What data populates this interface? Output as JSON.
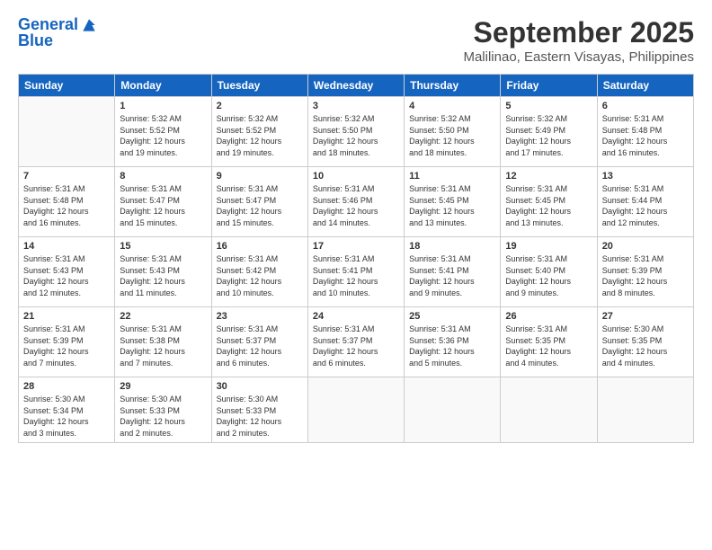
{
  "logo": {
    "line1": "General",
    "line2": "Blue"
  },
  "title": "September 2025",
  "location": "Malilinao, Eastern Visayas, Philippines",
  "days_of_week": [
    "Sunday",
    "Monday",
    "Tuesday",
    "Wednesday",
    "Thursday",
    "Friday",
    "Saturday"
  ],
  "weeks": [
    [
      {
        "day": "",
        "info": ""
      },
      {
        "day": "1",
        "info": "Sunrise: 5:32 AM\nSunset: 5:52 PM\nDaylight: 12 hours\nand 19 minutes."
      },
      {
        "day": "2",
        "info": "Sunrise: 5:32 AM\nSunset: 5:52 PM\nDaylight: 12 hours\nand 19 minutes."
      },
      {
        "day": "3",
        "info": "Sunrise: 5:32 AM\nSunset: 5:50 PM\nDaylight: 12 hours\nand 18 minutes."
      },
      {
        "day": "4",
        "info": "Sunrise: 5:32 AM\nSunset: 5:50 PM\nDaylight: 12 hours\nand 18 minutes."
      },
      {
        "day": "5",
        "info": "Sunrise: 5:32 AM\nSunset: 5:49 PM\nDaylight: 12 hours\nand 17 minutes."
      },
      {
        "day": "6",
        "info": "Sunrise: 5:31 AM\nSunset: 5:48 PM\nDaylight: 12 hours\nand 16 minutes."
      }
    ],
    [
      {
        "day": "7",
        "info": "Sunrise: 5:31 AM\nSunset: 5:48 PM\nDaylight: 12 hours\nand 16 minutes."
      },
      {
        "day": "8",
        "info": "Sunrise: 5:31 AM\nSunset: 5:47 PM\nDaylight: 12 hours\nand 15 minutes."
      },
      {
        "day": "9",
        "info": "Sunrise: 5:31 AM\nSunset: 5:47 PM\nDaylight: 12 hours\nand 15 minutes."
      },
      {
        "day": "10",
        "info": "Sunrise: 5:31 AM\nSunset: 5:46 PM\nDaylight: 12 hours\nand 14 minutes."
      },
      {
        "day": "11",
        "info": "Sunrise: 5:31 AM\nSunset: 5:45 PM\nDaylight: 12 hours\nand 13 minutes."
      },
      {
        "day": "12",
        "info": "Sunrise: 5:31 AM\nSunset: 5:45 PM\nDaylight: 12 hours\nand 13 minutes."
      },
      {
        "day": "13",
        "info": "Sunrise: 5:31 AM\nSunset: 5:44 PM\nDaylight: 12 hours\nand 12 minutes."
      }
    ],
    [
      {
        "day": "14",
        "info": "Sunrise: 5:31 AM\nSunset: 5:43 PM\nDaylight: 12 hours\nand 12 minutes."
      },
      {
        "day": "15",
        "info": "Sunrise: 5:31 AM\nSunset: 5:43 PM\nDaylight: 12 hours\nand 11 minutes."
      },
      {
        "day": "16",
        "info": "Sunrise: 5:31 AM\nSunset: 5:42 PM\nDaylight: 12 hours\nand 10 minutes."
      },
      {
        "day": "17",
        "info": "Sunrise: 5:31 AM\nSunset: 5:41 PM\nDaylight: 12 hours\nand 10 minutes."
      },
      {
        "day": "18",
        "info": "Sunrise: 5:31 AM\nSunset: 5:41 PM\nDaylight: 12 hours\nand 9 minutes."
      },
      {
        "day": "19",
        "info": "Sunrise: 5:31 AM\nSunset: 5:40 PM\nDaylight: 12 hours\nand 9 minutes."
      },
      {
        "day": "20",
        "info": "Sunrise: 5:31 AM\nSunset: 5:39 PM\nDaylight: 12 hours\nand 8 minutes."
      }
    ],
    [
      {
        "day": "21",
        "info": "Sunrise: 5:31 AM\nSunset: 5:39 PM\nDaylight: 12 hours\nand 7 minutes."
      },
      {
        "day": "22",
        "info": "Sunrise: 5:31 AM\nSunset: 5:38 PM\nDaylight: 12 hours\nand 7 minutes."
      },
      {
        "day": "23",
        "info": "Sunrise: 5:31 AM\nSunset: 5:37 PM\nDaylight: 12 hours\nand 6 minutes."
      },
      {
        "day": "24",
        "info": "Sunrise: 5:31 AM\nSunset: 5:37 PM\nDaylight: 12 hours\nand 6 minutes."
      },
      {
        "day": "25",
        "info": "Sunrise: 5:31 AM\nSunset: 5:36 PM\nDaylight: 12 hours\nand 5 minutes."
      },
      {
        "day": "26",
        "info": "Sunrise: 5:31 AM\nSunset: 5:35 PM\nDaylight: 12 hours\nand 4 minutes."
      },
      {
        "day": "27",
        "info": "Sunrise: 5:30 AM\nSunset: 5:35 PM\nDaylight: 12 hours\nand 4 minutes."
      }
    ],
    [
      {
        "day": "28",
        "info": "Sunrise: 5:30 AM\nSunset: 5:34 PM\nDaylight: 12 hours\nand 3 minutes."
      },
      {
        "day": "29",
        "info": "Sunrise: 5:30 AM\nSunset: 5:33 PM\nDaylight: 12 hours\nand 2 minutes."
      },
      {
        "day": "30",
        "info": "Sunrise: 5:30 AM\nSunset: 5:33 PM\nDaylight: 12 hours\nand 2 minutes."
      },
      {
        "day": "",
        "info": ""
      },
      {
        "day": "",
        "info": ""
      },
      {
        "day": "",
        "info": ""
      },
      {
        "day": "",
        "info": ""
      }
    ]
  ]
}
